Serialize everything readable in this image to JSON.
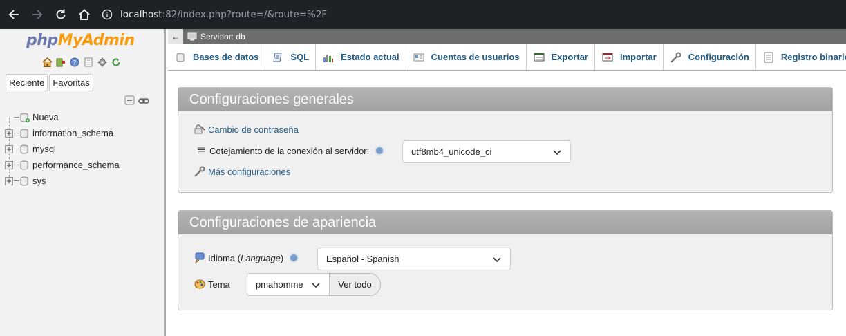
{
  "browser": {
    "url_host": "localhost",
    "url_rest": ":82/index.php?route=/&route=%2F"
  },
  "sidebar": {
    "logo_php": "php",
    "logo_myadmin": "MyAdmin",
    "tabs": [
      "Reciente",
      "Favoritas"
    ],
    "tree": [
      {
        "label": "Nueva",
        "expandable": false
      },
      {
        "label": "information_schema",
        "expandable": true
      },
      {
        "label": "mysql",
        "expandable": true
      },
      {
        "label": "performance_schema",
        "expandable": true
      },
      {
        "label": "sys",
        "expandable": true
      }
    ]
  },
  "server_bar": {
    "label": "Servidor: db"
  },
  "top_menu": [
    {
      "label": "Bases de datos",
      "icon": "database-icon"
    },
    {
      "label": "SQL",
      "icon": "sql-icon"
    },
    {
      "label": "Estado actual",
      "icon": "status-icon"
    },
    {
      "label": "Cuentas de usuarios",
      "icon": "users-icon"
    },
    {
      "label": "Exportar",
      "icon": "export-icon"
    },
    {
      "label": "Importar",
      "icon": "import-icon"
    },
    {
      "label": "Configuración",
      "icon": "wrench-icon"
    },
    {
      "label": "Registro binario",
      "icon": "log-icon"
    }
  ],
  "general": {
    "title": "Configuraciones generales",
    "change_password": "Cambio de contraseña",
    "collation_label": "Cotejamiento de la conexión al servidor:",
    "collation_value": "utf8mb4_unicode_ci",
    "more_settings": "Más configuraciones"
  },
  "appearance": {
    "title": "Configuraciones de apariencia",
    "language_label_pre": "Idioma (",
    "language_label_it": "Language",
    "language_label_post": ")",
    "language_value": "Español - Spanish",
    "theme_label": "Tema",
    "theme_value": "pmahomme",
    "view_all": "Ver todo"
  }
}
